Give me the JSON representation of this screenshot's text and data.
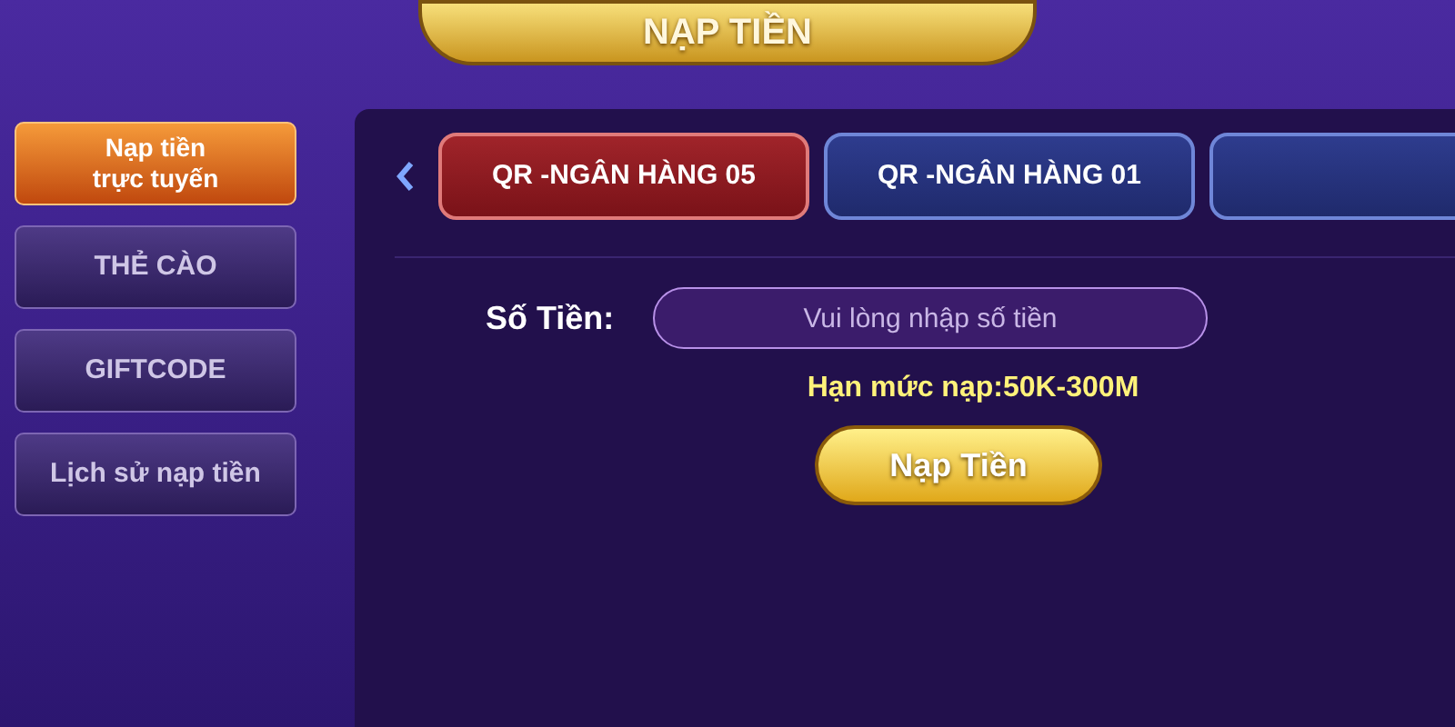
{
  "window": {
    "title": "NẠP TIỀN"
  },
  "sidebar": {
    "items": [
      {
        "label": "Nạp tiền\ntrực tuyến",
        "selected": true
      },
      {
        "label": "THẺ CÀO",
        "selected": false
      },
      {
        "label": "GIFTCODE",
        "selected": false
      },
      {
        "label": "Lịch sử nạp tiền",
        "selected": false
      }
    ]
  },
  "tabs": [
    {
      "label": "QR -NGÂN HÀNG 05",
      "selected": true
    },
    {
      "label": "QR -NGÂN HÀNG 01",
      "selected": false
    },
    {
      "selected": false
    }
  ],
  "form": {
    "amount_label": "Số Tiền:",
    "amount_placeholder": "Vui lòng nhập số tiền",
    "limit": "Hạn mức nạp:50K-300M",
    "submit": "Nạp Tiền"
  }
}
